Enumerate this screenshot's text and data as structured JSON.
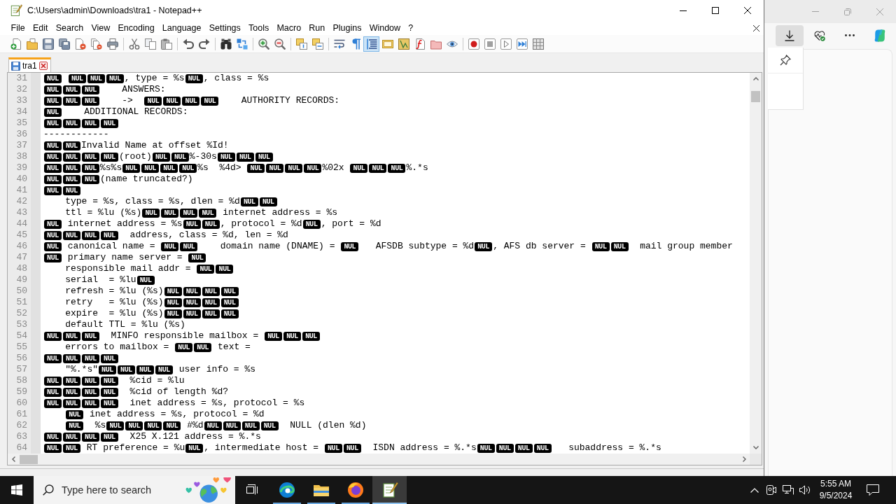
{
  "window": {
    "title": "C:\\Users\\admin\\Downloads\\tra1 - Notepad++"
  },
  "menu": [
    "File",
    "Edit",
    "Search",
    "View",
    "Encoding",
    "Language",
    "Settings",
    "Tools",
    "Macro",
    "Run",
    "Plugins",
    "Window",
    "?"
  ],
  "toolbar": [
    {
      "pressed": false
    },
    {
      "pressed": false
    },
    {
      "pressed": false
    },
    {
      "pressed": false
    },
    {
      "pressed": false
    },
    {
      "pressed": false
    },
    {
      "pressed": false
    },
    {
      "pressed": false
    },
    {
      "pressed": false
    },
    {
      "pressed": false
    },
    {
      "pressed": false
    },
    {
      "pressed": false
    },
    {
      "pressed": false
    },
    {
      "pressed": false
    },
    {
      "pressed": false
    },
    {
      "pressed": false
    },
    {
      "pressed": false
    },
    {
      "pressed": false
    },
    {
      "pressed": false
    },
    {
      "pressed": false
    },
    {
      "pressed": true
    },
    {
      "pressed": false
    },
    {
      "pressed": false
    },
    {
      "pressed": false
    },
    {
      "pressed": false
    },
    {
      "pressed": false
    },
    {
      "pressed": false
    },
    {
      "pressed": false
    },
    {
      "pressed": false
    },
    {
      "pressed": false
    },
    {
      "pressed": false
    }
  ],
  "tabs": [
    {
      "label": "tra1",
      "selected": true
    }
  ],
  "editor": {
    "lines": [
      {
        "number": "31",
        "indented": false,
        "segments": [
          {
            "kind": "nul",
            "marks": [
              "NUL"
            ]
          },
          {
            "kind": "space"
          },
          {
            "kind": "nul",
            "marks": [
              "NUL",
              "NUL",
              "NUL"
            ]
          },
          {
            "kind": "text",
            "text": ", type = %s"
          },
          {
            "kind": "nul",
            "marks": [
              "NUL"
            ]
          },
          {
            "kind": "text",
            "text": ", class = %s"
          }
        ]
      },
      {
        "number": "32",
        "indented": false,
        "segments": [
          {
            "kind": "nul",
            "marks": [
              "NUL",
              "NUL",
              "NUL"
            ]
          },
          {
            "kind": "text",
            "text": "    ANSWERS:"
          }
        ]
      },
      {
        "number": "33",
        "indented": false,
        "segments": [
          {
            "kind": "nul",
            "marks": [
              "NUL",
              "NUL",
              "NUL"
            ]
          },
          {
            "kind": "text",
            "text": "    ->  "
          },
          {
            "kind": "nul",
            "marks": [
              "NUL",
              "NUL",
              "NUL",
              "NUL"
            ]
          },
          {
            "kind": "text",
            "text": "    AUTHORITY RECORDS:"
          }
        ]
      },
      {
        "number": "34",
        "indented": false,
        "segments": [
          {
            "kind": "nul",
            "marks": [
              "NUL"
            ]
          },
          {
            "kind": "text",
            "text": "    ADDITIONAL RECORDS:"
          }
        ]
      },
      {
        "number": "35",
        "indented": false,
        "segments": [
          {
            "kind": "nul",
            "marks": [
              "NUL",
              "NUL",
              "NUL",
              "NUL"
            ]
          }
        ]
      },
      {
        "number": "36",
        "indented": false,
        "segments": [
          {
            "kind": "text",
            "text": "------------"
          }
        ]
      },
      {
        "number": "37",
        "indented": false,
        "segments": [
          {
            "kind": "nul",
            "marks": [
              "NUL",
              "NUL"
            ]
          },
          {
            "kind": "text",
            "text": "Invalid Name at offset %Id!"
          }
        ]
      },
      {
        "number": "38",
        "indented": false,
        "segments": [
          {
            "kind": "nul",
            "marks": [
              "NUL",
              "NUL",
              "NUL",
              "NUL"
            ]
          },
          {
            "kind": "text",
            "text": "(root)"
          },
          {
            "kind": "nul",
            "marks": [
              "NUL",
              "NUL"
            ]
          },
          {
            "kind": "text",
            "text": "%-30s"
          },
          {
            "kind": "nul",
            "marks": [
              "NUL",
              "NUL",
              "NUL"
            ]
          }
        ]
      },
      {
        "number": "39",
        "indented": false,
        "segments": [
          {
            "kind": "nul",
            "marks": [
              "NUL",
              "NUL",
              "NUL"
            ]
          },
          {
            "kind": "text",
            "text": "%s%s"
          },
          {
            "kind": "nul",
            "marks": [
              "NUL",
              "NUL",
              "NUL",
              "NUL"
            ]
          },
          {
            "kind": "text",
            "text": "%s  %4d> "
          },
          {
            "kind": "nul",
            "marks": [
              "NUL",
              "NUL",
              "NUL",
              "NUL"
            ]
          },
          {
            "kind": "text",
            "text": "%02x "
          },
          {
            "kind": "nul",
            "marks": [
              "NUL",
              "NUL",
              "NUL"
            ]
          },
          {
            "kind": "text",
            "text": "%.*s"
          }
        ]
      },
      {
        "number": "40",
        "indented": false,
        "segments": [
          {
            "kind": "nul",
            "marks": [
              "NUL",
              "NUL",
              "NUL"
            ]
          },
          {
            "kind": "text",
            "text": "(name truncated?)"
          }
        ]
      },
      {
        "number": "41",
        "indented": false,
        "segments": [
          {
            "kind": "nul",
            "marks": [
              "NUL",
              "NUL"
            ]
          }
        ]
      },
      {
        "number": "42",
        "indented": true,
        "segments": [
          {
            "kind": "text",
            "text": "type = %s, class = %s, dlen = %d"
          },
          {
            "kind": "nul",
            "marks": [
              "NUL",
              "NUL"
            ]
          }
        ]
      },
      {
        "number": "43",
        "indented": true,
        "segments": [
          {
            "kind": "text",
            "text": "ttl = %lu (%s)"
          },
          {
            "kind": "nul",
            "marks": [
              "NUL",
              "NUL",
              "NUL",
              "NUL"
            ]
          },
          {
            "kind": "text",
            "text": " internet address = %s"
          }
        ]
      },
      {
        "number": "44",
        "indented": false,
        "segments": [
          {
            "kind": "nul",
            "marks": [
              "NUL"
            ]
          },
          {
            "kind": "text",
            "text": " internet address = %s"
          },
          {
            "kind": "nul",
            "marks": [
              "NUL",
              "NUL"
            ]
          },
          {
            "kind": "text",
            "text": ", protocol = %d"
          },
          {
            "kind": "nul",
            "marks": [
              "NUL"
            ]
          },
          {
            "kind": "text",
            "text": ", port = %d"
          }
        ]
      },
      {
        "number": "45",
        "indented": false,
        "segments": [
          {
            "kind": "nul",
            "marks": [
              "NUL",
              "NUL",
              "NUL",
              "NUL"
            ]
          },
          {
            "kind": "text",
            "text": "  address, class = %d, len = %d"
          }
        ]
      },
      {
        "number": "46",
        "indented": false,
        "segments": [
          {
            "kind": "nul",
            "marks": [
              "NUL"
            ]
          },
          {
            "kind": "text",
            "text": " canonical name = "
          },
          {
            "kind": "nul",
            "marks": [
              "NUL",
              "NUL"
            ]
          },
          {
            "kind": "text",
            "text": "    domain name (DNAME) = "
          },
          {
            "kind": "nul",
            "marks": [
              "NUL"
            ]
          },
          {
            "kind": "text",
            "text": "   AFSDB subtype = %d"
          },
          {
            "kind": "nul",
            "marks": [
              "NUL"
            ]
          },
          {
            "kind": "text",
            "text": ", AFS db server = "
          },
          {
            "kind": "nul",
            "marks": [
              "NUL",
              "NUL"
            ]
          },
          {
            "kind": "text",
            "text": "  mail group member"
          }
        ]
      },
      {
        "number": "47",
        "indented": false,
        "segments": [
          {
            "kind": "nul",
            "marks": [
              "NUL"
            ]
          },
          {
            "kind": "text",
            "text": " primary name server = "
          },
          {
            "kind": "nul",
            "marks": [
              "NUL"
            ]
          }
        ]
      },
      {
        "number": "48",
        "indented": true,
        "segments": [
          {
            "kind": "text",
            "text": "responsible mail addr = "
          },
          {
            "kind": "nul",
            "marks": [
              "NUL",
              "NUL"
            ]
          }
        ]
      },
      {
        "number": "49",
        "indented": true,
        "segments": [
          {
            "kind": "text",
            "text": "serial  = %lu"
          },
          {
            "kind": "nul",
            "marks": [
              "NUL"
            ]
          }
        ]
      },
      {
        "number": "50",
        "indented": true,
        "segments": [
          {
            "kind": "text",
            "text": "refresh = %lu (%s)"
          },
          {
            "kind": "nul",
            "marks": [
              "NUL",
              "NUL",
              "NUL",
              "NUL"
            ]
          }
        ]
      },
      {
        "number": "51",
        "indented": true,
        "segments": [
          {
            "kind": "text",
            "text": "retry   = %lu (%s)"
          },
          {
            "kind": "nul",
            "marks": [
              "NUL",
              "NUL",
              "NUL",
              "NUL"
            ]
          }
        ]
      },
      {
        "number": "52",
        "indented": true,
        "segments": [
          {
            "kind": "text",
            "text": "expire  = %lu (%s)"
          },
          {
            "kind": "nul",
            "marks": [
              "NUL",
              "NUL",
              "NUL",
              "NUL"
            ]
          }
        ]
      },
      {
        "number": "53",
        "indented": true,
        "segments": [
          {
            "kind": "text",
            "text": "default TTL = %lu (%s)"
          }
        ]
      },
      {
        "number": "54",
        "indented": false,
        "segments": [
          {
            "kind": "nul",
            "marks": [
              "NUL",
              "NUL",
              "NUL"
            ]
          },
          {
            "kind": "text",
            "text": "  MINFO responsible mailbox = "
          },
          {
            "kind": "nul",
            "marks": [
              "NUL",
              "NUL",
              "NUL"
            ]
          }
        ]
      },
      {
        "number": "55",
        "indented": true,
        "segments": [
          {
            "kind": "text",
            "text": "errors to mailbox = "
          },
          {
            "kind": "nul",
            "marks": [
              "NUL",
              "NUL"
            ]
          },
          {
            "kind": "text",
            "text": " text ="
          }
        ]
      },
      {
        "number": "56",
        "indented": false,
        "segments": [
          {
            "kind": "nul",
            "marks": [
              "NUL",
              "NUL",
              "NUL",
              "NUL"
            ]
          }
        ]
      },
      {
        "number": "57",
        "indented": true,
        "segments": [
          {
            "kind": "text",
            "text": "\"%.*s\""
          },
          {
            "kind": "nul",
            "marks": [
              "NUL",
              "NUL",
              "NUL",
              "NUL"
            ]
          },
          {
            "kind": "text",
            "text": " user info = %s"
          }
        ]
      },
      {
        "number": "58",
        "indented": false,
        "segments": [
          {
            "kind": "nul",
            "marks": [
              "NUL",
              "NUL",
              "NUL",
              "NUL"
            ]
          },
          {
            "kind": "text",
            "text": "  %cid = %lu"
          }
        ]
      },
      {
        "number": "59",
        "indented": false,
        "segments": [
          {
            "kind": "nul",
            "marks": [
              "NUL",
              "NUL",
              "NUL",
              "NUL"
            ]
          },
          {
            "kind": "text",
            "text": "  %cid of length %d?"
          }
        ]
      },
      {
        "number": "60",
        "indented": false,
        "segments": [
          {
            "kind": "nul",
            "marks": [
              "NUL",
              "NUL",
              "NUL",
              "NUL"
            ]
          },
          {
            "kind": "text",
            "text": "  inet address = %s, protocol = %s"
          }
        ]
      },
      {
        "number": "61",
        "indented": true,
        "segments": [
          {
            "kind": "nul",
            "marks": [
              "NUL"
            ]
          },
          {
            "kind": "text",
            "text": " inet address = %s, protocol = %d"
          }
        ]
      },
      {
        "number": "62",
        "indented": true,
        "segments": [
          {
            "kind": "nul",
            "marks": [
              "NUL"
            ]
          },
          {
            "kind": "text",
            "text": "  %s"
          },
          {
            "kind": "nul",
            "marks": [
              "NUL",
              "NUL",
              "NUL",
              "NUL"
            ]
          },
          {
            "kind": "text",
            "text": " #%d"
          },
          {
            "kind": "nul",
            "marks": [
              "NUL",
              "NUL",
              "NUL",
              "NUL"
            ]
          },
          {
            "kind": "text",
            "text": "  NULL (dlen %d)"
          }
        ]
      },
      {
        "number": "63",
        "indented": false,
        "segments": [
          {
            "kind": "nul",
            "marks": [
              "NUL",
              "NUL",
              "NUL",
              "NUL"
            ]
          },
          {
            "kind": "text",
            "text": "  X25 X.121 address = %.*s"
          }
        ]
      },
      {
        "number": "64",
        "indented": false,
        "segments": [
          {
            "kind": "nul",
            "marks": [
              "NUL",
              "NUL"
            ]
          },
          {
            "kind": "text",
            "text": " RT preference = %u"
          },
          {
            "kind": "nul",
            "marks": [
              "NUL"
            ]
          },
          {
            "kind": "text",
            "text": ", intermediate host = "
          },
          {
            "kind": "nul",
            "marks": [
              "NUL",
              "NUL"
            ]
          },
          {
            "kind": "text",
            "text": "  ISDN address = %.*s"
          },
          {
            "kind": "nul",
            "marks": [
              "NUL",
              "NUL",
              "NUL",
              "NUL"
            ]
          },
          {
            "kind": "text",
            "text": "   subaddress = %.*s"
          }
        ]
      }
    ]
  },
  "browser": {
    "toolbar": [
      {
        "pressed": true
      },
      {
        "pressed": false
      },
      {
        "pressed": false
      },
      {
        "pressed": false
      }
    ]
  },
  "taskbar": {
    "search": {
      "placeholder": "Type here to search"
    },
    "apps": [
      {
        "running": true,
        "active": false
      },
      {
        "running": true,
        "active": false
      },
      {
        "running": true,
        "active": false
      },
      {
        "running": true,
        "active": true
      }
    ],
    "time": "5:55 AM",
    "date": "9/5/2024"
  }
}
